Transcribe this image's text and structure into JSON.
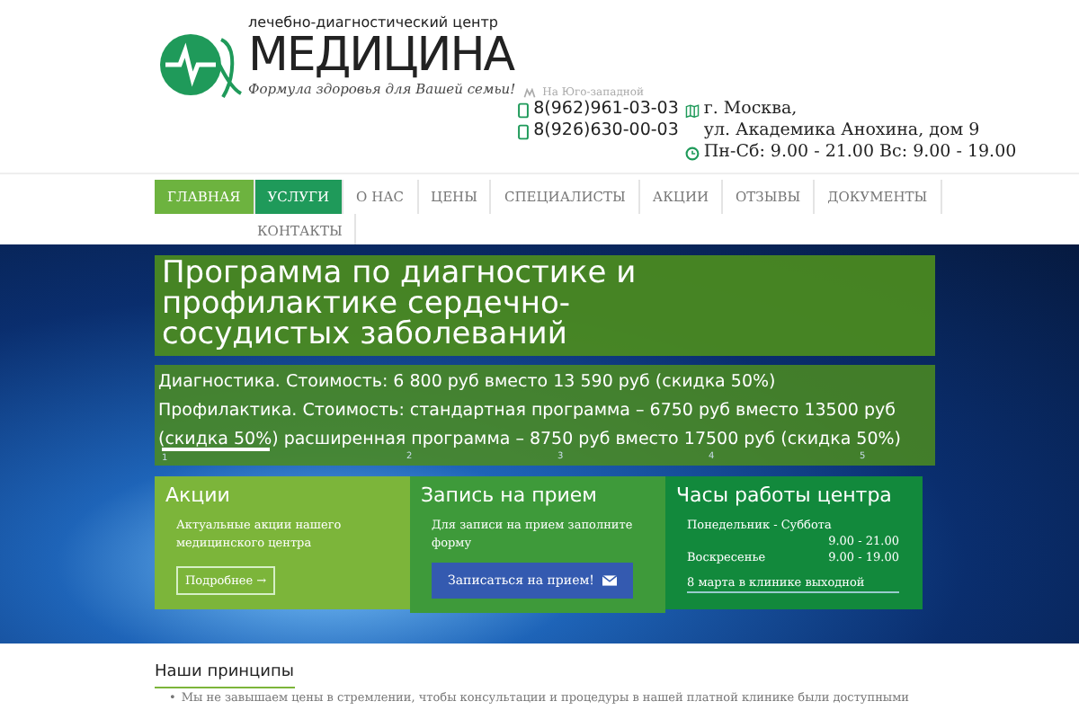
{
  "logo": {
    "subtitle": "лечебно-диагностический центр",
    "name": "МЕДИЦИНА",
    "slogan": "Формула здоровья для Вашей семьи!"
  },
  "contacts": {
    "metro": "На Юго-западной",
    "phones": [
      "8(962)961-03-03",
      "8(926)630-00-03"
    ],
    "address_lines": [
      "г. Москва,",
      "ул. Академика Анохина, дом 9"
    ],
    "hours": "Пн-Сб: 9.00 - 21.00 Вс: 9.00 - 19.00"
  },
  "nav": [
    {
      "label": "ГЛАВНАЯ",
      "selected": true
    },
    {
      "label": "УСЛУГИ",
      "selected": false,
      "hover": true
    },
    {
      "label": "О НАС",
      "selected": false
    },
    {
      "label": "ЦЕНЫ",
      "selected": false
    },
    {
      "label": "СПЕЦИАЛИСТЫ",
      "selected": false
    },
    {
      "label": "АКЦИИ",
      "selected": false
    },
    {
      "label": "ОТЗЫВЫ",
      "selected": false
    },
    {
      "label": "ДОКУМЕНТЫ",
      "selected": false
    },
    {
      "label": "КОНТАКТЫ",
      "selected": false
    }
  ],
  "slide": {
    "title": "Программа по диагностике и профилактике сердечно-сосудистых заболеваний",
    "text_lines": [
      "Диагностика. Стоимость: 6 800 руб вместо 13 590 руб (скидка 50%)",
      "Профилактика. Стоимость: стандартная программа – 6750 руб вместо 13500 руб (скидка 50%) расширенная программа – 8750 руб вместо 17500 руб (скидка 50%)"
    ],
    "pager": [
      {
        "label": "1",
        "selected": true
      },
      {
        "label": "2",
        "selected": false
      },
      {
        "label": "3",
        "selected": false
      },
      {
        "label": "4",
        "selected": false
      },
      {
        "label": "5",
        "selected": false
      }
    ]
  },
  "cards": [
    {
      "kind": "promo",
      "title": "Акции",
      "text": "Актуальные акции нашего медицинского центра",
      "button": "Подробнее →"
    },
    {
      "kind": "booking",
      "title": "Запись на прием",
      "text": "Для записи на прием заполните форму",
      "button": "Записаться на прием!"
    },
    {
      "kind": "hours",
      "title": "Часы работы центра",
      "rows": [
        {
          "day": "Понедельник - Суббота",
          "time": "9.00 - 21.00"
        },
        {
          "day": "Воскресенье",
          "time": "9.00 - 19.00"
        }
      ],
      "note": "8 марта в клинике выходной"
    }
  ],
  "principles": {
    "title": "Наши принципы",
    "items": [
      {
        "marker": "•",
        "text": "Мы не завышаем цены в стремлении, чтобы консультации и процедуры в нашей платной клинике были доступными"
      }
    ]
  }
}
